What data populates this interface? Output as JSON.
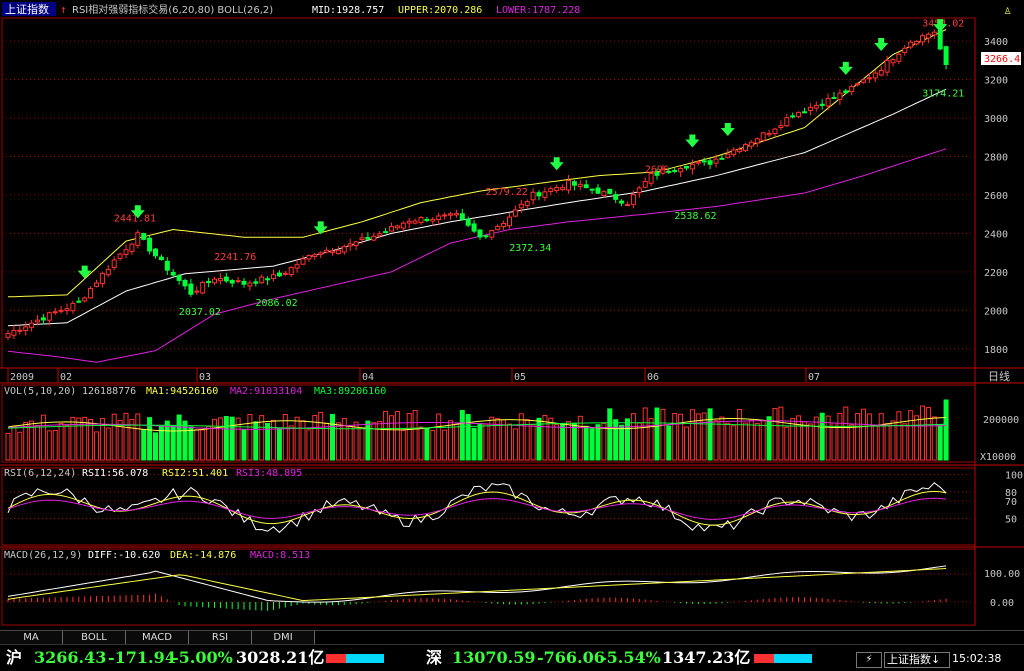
{
  "header": {
    "index_name": "上证指数",
    "boll": {
      "label": "RSI相对强弱指标交易(6,20,80) BOLL(26,2)",
      "mid": "MID:1928.757",
      "upper": "UPPER:2070.286",
      "lower": "LOWER:1787.228"
    }
  },
  "chart_data": {
    "type": "candlestick",
    "y_ticks": [
      1800,
      2000,
      2200,
      2400,
      2600,
      2800,
      3000,
      3200,
      3400
    ],
    "ylim": [
      1700,
      3520
    ],
    "x_labels": [
      "2009",
      "02",
      "03",
      "04",
      "05",
      "06",
      "07"
    ],
    "period_label": "日线",
    "current_price_label": "3266.4",
    "price_annotations": [
      {
        "text": "3454.02",
        "x": 158,
        "y": 3454,
        "color": "#ff3b3b"
      },
      {
        "text": "3174.21",
        "x": 158,
        "y": 3174,
        "color": "#3cff3c"
      },
      {
        "text": "2696",
        "x": 111,
        "y": 2696,
        "color": "#ff3b3b"
      },
      {
        "text": "2538.62",
        "x": 116,
        "y": 2538,
        "color": "#3cff3c"
      },
      {
        "text": "2579.22",
        "x": 84,
        "y": 2579,
        "color": "#ff3b3b"
      },
      {
        "text": "2372.34",
        "x": 88,
        "y": 2372,
        "color": "#3cff3c"
      },
      {
        "text": "2441.81",
        "x": 21,
        "y": 2441,
        "color": "#ff3b3b"
      },
      {
        "text": "2241.76",
        "x": 38,
        "y": 2241,
        "color": "#ff3b3b"
      },
      {
        "text": "2037.02",
        "x": 32,
        "y": 2037,
        "color": "#3cff3c"
      },
      {
        "text": "2086.02",
        "x": 45,
        "y": 2086,
        "color": "#3cff3c"
      }
    ],
    "signal_arrows": [
      13,
      22,
      53,
      93,
      116,
      122,
      142,
      148,
      158
    ],
    "close_anchors": [
      [
        0,
        1880
      ],
      [
        8,
        1990
      ],
      [
        12,
        2040
      ],
      [
        18,
        2260
      ],
      [
        22,
        2390
      ],
      [
        26,
        2250
      ],
      [
        31,
        2090
      ],
      [
        35,
        2170
      ],
      [
        40,
        2140
      ],
      [
        46,
        2180
      ],
      [
        52,
        2300
      ],
      [
        58,
        2340
      ],
      [
        64,
        2410
      ],
      [
        68,
        2470
      ],
      [
        76,
        2490
      ],
      [
        80,
        2380
      ],
      [
        84,
        2460
      ],
      [
        89,
        2600
      ],
      [
        95,
        2660
      ],
      [
        100,
        2620
      ],
      [
        105,
        2560
      ],
      [
        109,
        2700
      ],
      [
        114,
        2750
      ],
      [
        119,
        2770
      ],
      [
        124,
        2850
      ],
      [
        129,
        2930
      ],
      [
        133,
        3020
      ],
      [
        138,
        3080
      ],
      [
        143,
        3150
      ],
      [
        148,
        3260
      ],
      [
        153,
        3400
      ],
      [
        157,
        3450
      ],
      [
        159,
        3266
      ]
    ],
    "boll_mid_anchors": [
      [
        0,
        1920
      ],
      [
        10,
        1935
      ],
      [
        20,
        2100
      ],
      [
        30,
        2190
      ],
      [
        45,
        2230
      ],
      [
        55,
        2310
      ],
      [
        65,
        2400
      ],
      [
        75,
        2460
      ],
      [
        85,
        2510
      ],
      [
        95,
        2560
      ],
      [
        108,
        2620
      ],
      [
        120,
        2700
      ],
      [
        135,
        2820
      ],
      [
        150,
        3020
      ],
      [
        159,
        3150
      ]
    ],
    "boll_upper_anchors": [
      [
        0,
        2070
      ],
      [
        10,
        2080
      ],
      [
        20,
        2360
      ],
      [
        28,
        2420
      ],
      [
        40,
        2380
      ],
      [
        50,
        2380
      ],
      [
        60,
        2460
      ],
      [
        70,
        2560
      ],
      [
        80,
        2620
      ],
      [
        90,
        2660
      ],
      [
        100,
        2700
      ],
      [
        110,
        2720
      ],
      [
        120,
        2800
      ],
      [
        135,
        2950
      ],
      [
        150,
        3330
      ],
      [
        159,
        3460
      ]
    ],
    "boll_lower_anchors": [
      [
        0,
        1787
      ],
      [
        8,
        1760
      ],
      [
        15,
        1730
      ],
      [
        25,
        1790
      ],
      [
        35,
        1980
      ],
      [
        45,
        2060
      ],
      [
        55,
        2130
      ],
      [
        65,
        2200
      ],
      [
        75,
        2350
      ],
      [
        85,
        2420
      ],
      [
        95,
        2460
      ],
      [
        108,
        2500
      ],
      [
        120,
        2540
      ],
      [
        135,
        2610
      ],
      [
        145,
        2700
      ],
      [
        159,
        2840
      ]
    ],
    "volume": {
      "label": "VOL(5,10,20)",
      "value": "126188776",
      "ma1": "MA1:94526160",
      "ma2": "MA2:91033104",
      "ma3": "MA3:89206160",
      "y_tick": "200000",
      "unit_label": "X10000"
    },
    "rsi": {
      "label": "RSI(6,12,24)",
      "rsi1": "RSI1:56.078",
      "rsi2": "RSI2:51.401",
      "rsi3": "RSI3:48.895",
      "y_ticks": [
        50,
        70,
        80,
        100
      ]
    },
    "macd": {
      "label": "MACD(26,12,9)",
      "diff": "DIFF:-10.620",
      "dea": "DEA:-14.876",
      "macd": "MACD:8.513",
      "y_ticks": [
        "100.00",
        "0.00"
      ]
    }
  },
  "tabs": [
    "MA",
    "BOLL",
    "MACD",
    "RSI",
    "DMI"
  ],
  "status_bar": {
    "sh_label": "沪",
    "sh_index": "3266.43",
    "sh_change": "-171.94",
    "sh_pct": "-5.00%",
    "sh_amount": "3028.21亿",
    "sz_label": "深",
    "sz_index": "13070.59",
    "sz_change": "-766.06",
    "sz_pct": "-5.54%",
    "sz_amount": "1347.23亿",
    "index_select": "上证指数",
    "time": "15:02:38"
  },
  "colors": {
    "up": "#ff3030",
    "down": "#00ff3a",
    "upper": "#ffff44",
    "mid": "#ffffff",
    "lower": "#e020e0",
    "grid": "#8b0000"
  }
}
